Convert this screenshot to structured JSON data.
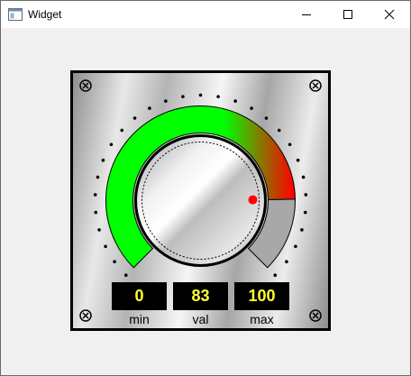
{
  "window": {
    "title": "Widget",
    "icon": "app-window-icon",
    "controls": [
      "minimize-icon",
      "maximize-icon",
      "close-icon"
    ]
  },
  "gauge": {
    "min": 0,
    "value": 83,
    "max": 100,
    "colors": {
      "low": "#00ff00",
      "high": "#ff0000",
      "remaining": "#a8a8a8",
      "indicator": "#ff0000",
      "display_bg": "#000000",
      "display_text": "#ffff33"
    },
    "displays": {
      "min": {
        "value": "0",
        "label": "min"
      },
      "val": {
        "value": "83",
        "label": "val"
      },
      "max": {
        "value": "100",
        "label": "max"
      }
    }
  }
}
